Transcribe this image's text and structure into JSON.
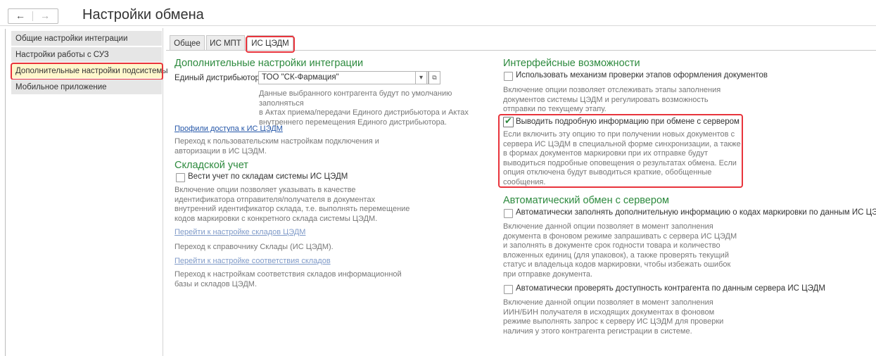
{
  "window": {
    "title": "Настройки обмена",
    "back_icon": "←",
    "forward_icon": "→"
  },
  "sidebar": {
    "items": [
      {
        "label": "Общие настройки интеграции"
      },
      {
        "label": "Настройки работы с СУЗ"
      },
      {
        "label": "Дополнительные настройки подсистемы",
        "selected": true
      },
      {
        "label": "Мобильное приложение"
      }
    ]
  },
  "tabs": [
    {
      "label": "Общее"
    },
    {
      "label": "ИС МПТ"
    },
    {
      "label": "ИС ЦЭДМ",
      "active": true
    }
  ],
  "left_col": {
    "integration": {
      "heading": "Дополнительные настройки интеграции",
      "distributor_label": "Единый дистрибьютор:",
      "distributor_value": "ТОО \"СК-Фармация\"",
      "dropdown_icon": "▾",
      "open_icon": "⧉",
      "hint": [
        "Данные выбранного контрагента будут по умолчанию заполняться",
        "в Актах приема/передачи Единого дистрибьютора и Актах",
        "внутреннего перемещения Единого дистрибьютора."
      ]
    },
    "profiles": {
      "link": "Профили доступа к ИС ЦЭДМ",
      "hint": [
        "Переход к пользовательским настройкам подключения и",
        "авторизации в ИС ЦЭДМ."
      ]
    },
    "warehouse": {
      "heading": "Складской учет",
      "checkbox_label": "Вести учет по складам системы ИС ЦЭДМ",
      "checked": false,
      "hint": [
        "Включение опции позволяет указывать в качестве",
        "идентификатора отправителя/получателя в документах",
        "внутренний идентификатор склада, т.е. выполнять перемещение",
        "кодов маркировки с конкретного склада системы ЦЭДМ."
      ],
      "link1": "Перейти к настройке складов ЦЭДМ",
      "link1_hint": "Переход к справочнику Склады (ИС ЦЭДМ).",
      "link2": "Перейти к настройке соответствия складов",
      "link2_hint": [
        "Переход к настройкам соответствия складов информационной",
        "базы и складов ЦЭДМ."
      ]
    }
  },
  "right_col": {
    "interface": {
      "heading": "Интерфейсные возможности",
      "opt1_label": "Использовать механизм проверки этапов оформления документов",
      "opt1_checked": false,
      "opt1_hint": [
        "Включение опции позволяет отслеживать этапы заполнения",
        "документов системы ЦЭДМ и регулировать возможность",
        "отправки по текущему этапу."
      ],
      "opt2_label": "Выводить подробную информацию при обмене с сервером",
      "opt2_checked": true,
      "check_mark": "✔",
      "opt2_hint": [
        "Если включить эту опцию то при получении новых документов с",
        "сервера ИС ЦЭДМ в специальной форме синхронизации, а также",
        "в формах документов маркировки при их отправке будут",
        "выводиться подробные оповещения о результатах обмена. Если",
        "опция отключена будут выводиться краткие, обобщенные",
        "сообщения."
      ]
    },
    "auto": {
      "heading": "Автоматический обмен с сервером",
      "opt1_label": "Автоматически заполнять дополнительную информацию о кодах маркировки по данным ИС ЦЭДМ",
      "opt1_checked": false,
      "opt1_hint": [
        "Включение данной опции позволяет в момент заполнения",
        "документа в фоновом режиме запрашивать с сервера ИС ЦЭДМ",
        "и заполнять в документе срок годности товара и количество",
        "вложенных единиц (для упаковок), а также проверять текущий",
        "статус и владельца кодов маркировки, чтобы избежать ошибок",
        "при отправке документа."
      ],
      "opt2_label": "Автоматически проверять доступность контрагента по данным сервера ИС ЦЭДМ",
      "opt2_checked": false,
      "opt2_hint": [
        "Включение данной опции позволяет в момент заполнения",
        "ИИН/БИН получателя в исходящих документах в фоновом",
        "режиме выполнять запрос к серверу ИС ЦЭДМ для проверки",
        "наличия у этого контрагента регистрации в системе."
      ]
    }
  }
}
